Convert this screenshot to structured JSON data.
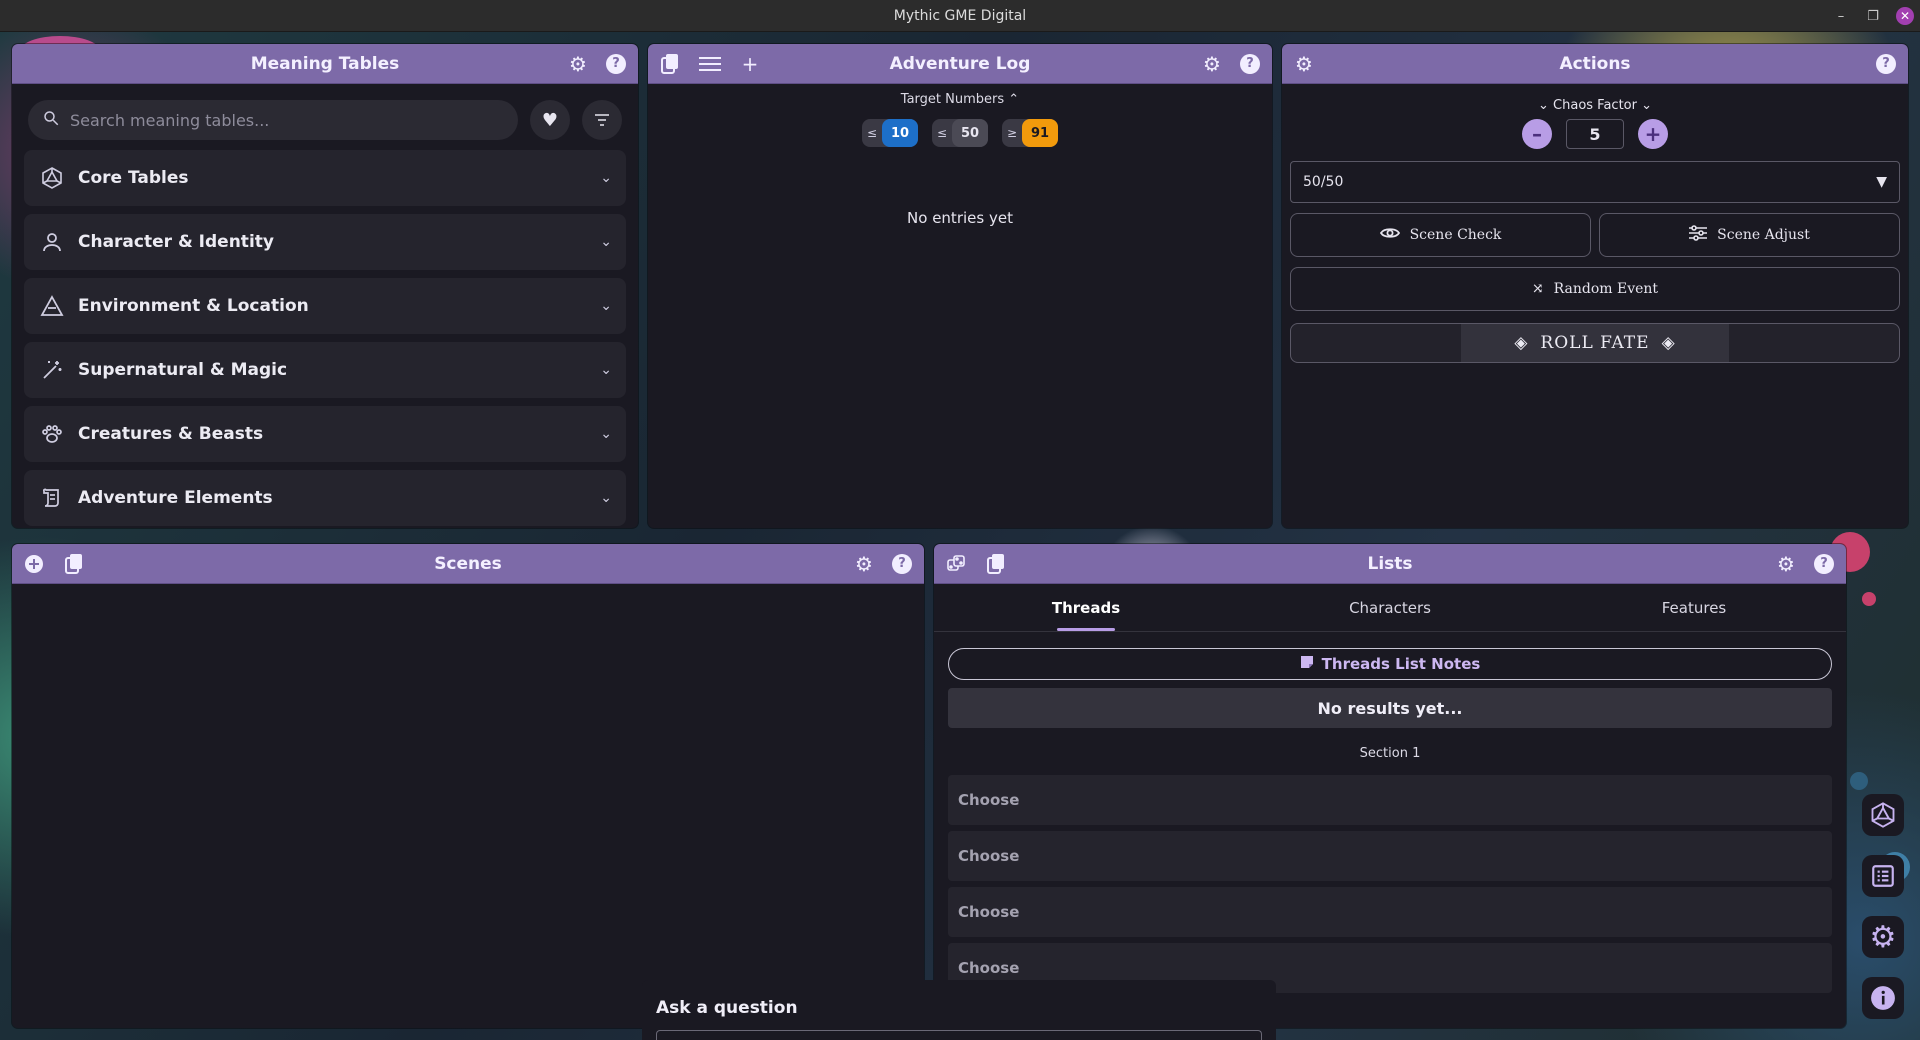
{
  "window": {
    "title": "Mythic GME Digital"
  },
  "meaning_tables": {
    "title": "Meaning Tables",
    "search_placeholder": "Search meaning tables...",
    "categories": [
      {
        "label": "Core Tables",
        "icon": "d20-icon"
      },
      {
        "label": "Character & Identity",
        "icon": "person-icon"
      },
      {
        "label": "Environment & Location",
        "icon": "mountain-icon"
      },
      {
        "label": "Supernatural & Magic",
        "icon": "magic-wand-icon"
      },
      {
        "label": "Creatures & Beasts",
        "icon": "paw-icon"
      },
      {
        "label": "Adventure Elements",
        "icon": "scroll-icon"
      }
    ]
  },
  "adventure_log": {
    "title": "Adventure Log",
    "target_numbers_label": "Target Numbers",
    "targets": [
      {
        "op": "≤",
        "value": "10",
        "color": "#1d6fc8"
      },
      {
        "op": "≤",
        "value": "50",
        "color": "#4b4a55"
      },
      {
        "op": "≥",
        "value": "91",
        "color": "#f29a0c"
      }
    ],
    "empty_text": "No entries yet"
  },
  "actions": {
    "title": "Actions",
    "chaos_label": "Chaos Factor",
    "chaos_value": "5",
    "odds_value": "50/50",
    "scene_check": "Scene Check",
    "scene_adjust": "Scene Adjust",
    "random_event": "Random Event",
    "roll_fate": "ROLL FATE"
  },
  "scenes": {
    "title": "Scenes"
  },
  "lists": {
    "title": "Lists",
    "tabs": [
      "Threads",
      "Characters",
      "Features"
    ],
    "active_tab": "Threads",
    "notes_button": "Threads List Notes",
    "no_results": "No results yet...",
    "section_label": "Section 1",
    "choose_items": [
      "Choose",
      "Choose",
      "Choose",
      "Choose"
    ]
  },
  "ask": {
    "title": "Ask a question"
  },
  "colors": {
    "header": "#7d6aa8",
    "panel": "#1a1922",
    "accent": "#b89de6"
  }
}
